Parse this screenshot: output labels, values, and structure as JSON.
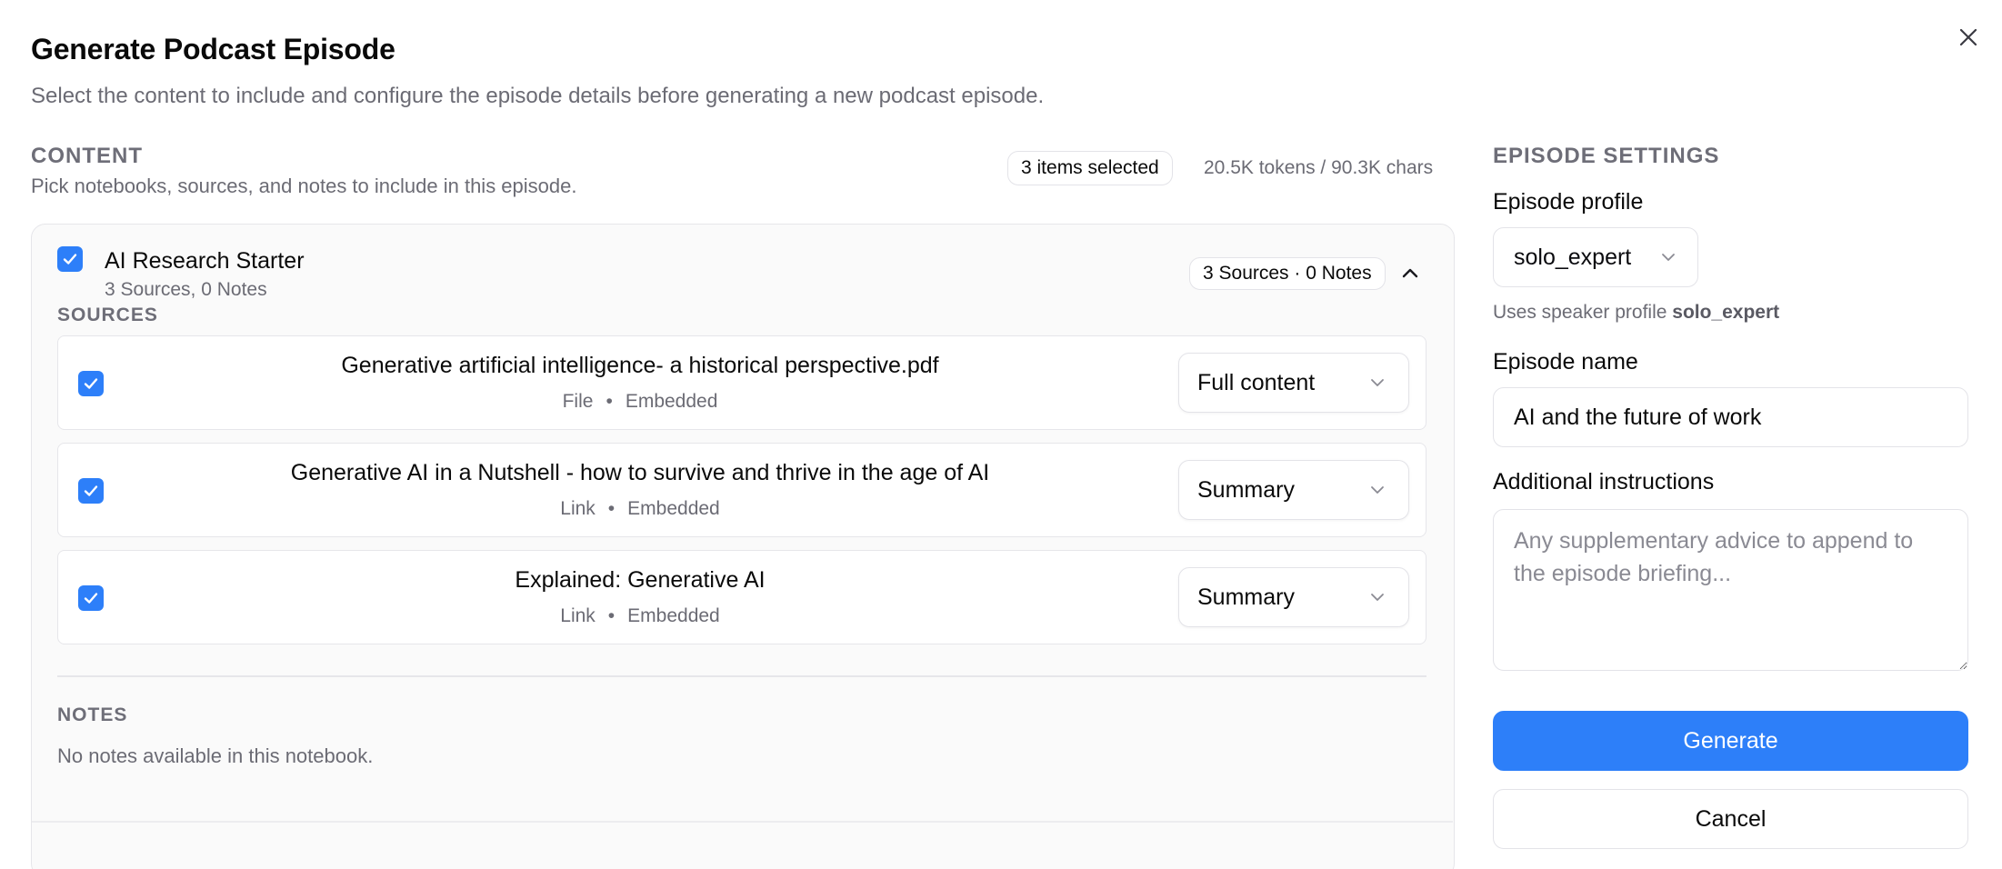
{
  "dialog": {
    "title": "Generate Podcast Episode",
    "subtitle": "Select the content to include and configure the episode details before generating a new podcast episode."
  },
  "content": {
    "label": "Content",
    "description": "Pick notebooks, sources, and notes to include in this episode.",
    "selected_count": "3 items selected",
    "token_info": "20.5K tokens / 90.3K chars"
  },
  "notebook": {
    "title": "AI Research Starter",
    "subtitle": "3 Sources, 0 Notes",
    "counts_pill": "3 Sources · 0 Notes",
    "checked": true,
    "expanded": true,
    "sources_label": "Sources",
    "sources": [
      {
        "title": "Generative artificial intelligence- a historical perspective.pdf",
        "type": "File",
        "status": "Embedded",
        "mode": "Full content",
        "checked": true
      },
      {
        "title": "Generative AI in a Nutshell - how to survive and thrive in the age of AI",
        "type": "Link",
        "status": "Embedded",
        "mode": "Summary",
        "checked": true
      },
      {
        "title": "Explained: Generative AI",
        "type": "Link",
        "status": "Embedded",
        "mode": "Summary",
        "checked": true
      }
    ],
    "notes_label": "Notes",
    "notes_empty": "No notes available in this notebook."
  },
  "settings": {
    "label": "Episode Settings",
    "profile_label": "Episode profile",
    "profile_value": "solo_expert",
    "profile_hint_prefix": "Uses speaker profile ",
    "profile_hint_value": "solo_expert",
    "name_label": "Episode name",
    "name_value": "AI and the future of work",
    "instructions_label": "Additional instructions",
    "instructions_placeholder": "Any supplementary advice to append to the episode briefing...",
    "generate_label": "Generate",
    "cancel_label": "Cancel"
  },
  "colors": {
    "accent": "#2d7ff9",
    "muted_text": "#6b6b74",
    "border": "#e3e3e8"
  },
  "icons": {
    "close": "close-icon",
    "checkbox": "check-icon",
    "collapse": "chevron-up-icon",
    "select": "chevron-down-icon"
  }
}
